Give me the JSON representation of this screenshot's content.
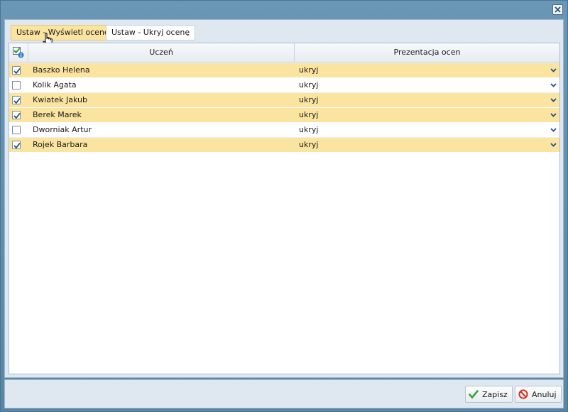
{
  "toolbar": {
    "show_grade_label": "Ustaw - Wyświetl ocenę",
    "hide_grade_label": "Ustaw - Ukryj ocenę"
  },
  "grid": {
    "columns": {
      "select_all_icon": "check-info-icon",
      "student": "Uczeń",
      "presentation": "Prezentacja ocen"
    },
    "rows": [
      {
        "name": "Baszko Helena",
        "checked": true,
        "presentation": "ukryj"
      },
      {
        "name": "Kolik Agata",
        "checked": false,
        "presentation": "ukryj"
      },
      {
        "name": "Kwiatek Jakub",
        "checked": true,
        "presentation": "ukryj"
      },
      {
        "name": "Berek Marek",
        "checked": true,
        "presentation": "ukryj"
      },
      {
        "name": "Dworniak Artur",
        "checked": false,
        "presentation": "ukryj"
      },
      {
        "name": "Rojek Barbara",
        "checked": true,
        "presentation": "ukryj"
      }
    ]
  },
  "footer": {
    "save_label": "Zapisz",
    "cancel_label": "Anuluj"
  },
  "colors": {
    "selected_row": "#fbe3a0",
    "window_frame": "#5f8bab",
    "panel": "#dfe8f1"
  }
}
